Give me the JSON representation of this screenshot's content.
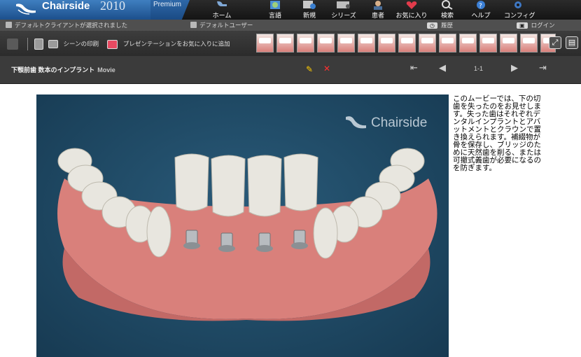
{
  "app": {
    "name": "Chairside",
    "year": "2010",
    "edition": "Premium"
  },
  "nav": [
    {
      "label": "ホーム",
      "icon": "home-chair-icon"
    },
    {
      "label": "言語",
      "icon": "globe-book-icon"
    },
    {
      "label": "新規",
      "icon": "new-screen-icon"
    },
    {
      "label": "シリーズ",
      "icon": "film-series-icon"
    },
    {
      "label": "患者",
      "icon": "patient-icon"
    },
    {
      "label": "お気に入り",
      "icon": "favorites-heart-icon"
    },
    {
      "label": "検索",
      "icon": "search-magnifier-icon"
    },
    {
      "label": "ヘルプ",
      "icon": "help-question-icon"
    },
    {
      "label": "コンフィグ",
      "icon": "config-gear-icon"
    }
  ],
  "status": {
    "client": "デフォルトクライアントが選択されました",
    "user": "デフォルトユーザー",
    "history": "履歴",
    "login": "ログイン"
  },
  "toolbar": {
    "print_label": "シーンの印刷",
    "fav_label": "プレゼンテーションをお気に入りに追加",
    "thumbnail_count": 15
  },
  "movie": {
    "title": "下顎前歯 数本のインプラント",
    "tag": "Movie",
    "page": "1-1",
    "watermark": "Chairside",
    "description": "このムービーでは、下の切歯を失ったのをお見せします。失った歯はそれぞれデンタルインプラントとアバットメントとクラウンで置き換えられます。補綴物が骨を保存し、ブリッジのために天然歯を削る、または可撤式義歯が必要になるのを防ぎます。"
  },
  "colors": {
    "brand_blue": "#2e68a8",
    "gum": "#d9807b",
    "movie_bg": "#1f4964"
  }
}
